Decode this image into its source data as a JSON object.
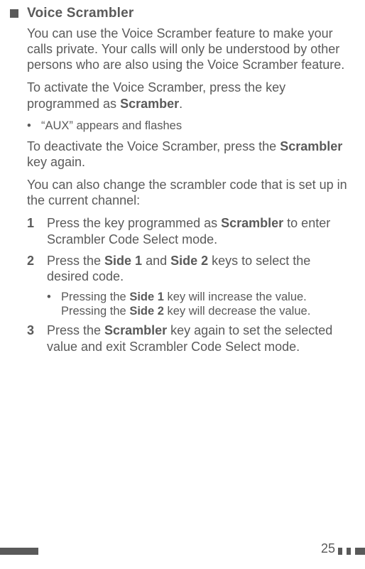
{
  "heading": "Voice Scrambler",
  "p1": "You can use the Voice Scramber feature to make your calls private.  Your calls will only be understood by other persons who are also using the Voice Scramber feature.",
  "p2a": "To activate the Voice Scramber, press the key programmed as ",
  "p2b": "Scramber",
  "p2c": ".",
  "bul1": "“AUX” appears and flashes",
  "p3a": "To deactivate the Voice Scramber, press the ",
  "p3b": "Scrambler",
  "p3c": " key again.",
  "p4": "You can also change the scrambler code that is set up in the current channel:",
  "s1a": "Press the key programmed as ",
  "s1b": "Scrambler",
  "s1c": " to enter Scrambler Code Select mode.",
  "s2a": "Press the ",
  "s2b": "Side 1",
  "s2c": " and ",
  "s2d": "Side 2",
  "s2e": " keys to select the desired code.",
  "s2sub_a": "Pressing the ",
  "s2sub_b": "Side 1",
  "s2sub_c": " key will increase the value. Pressing the ",
  "s2sub_d": "Side 2",
  "s2sub_e": " key will decrease the value.",
  "s3a": "Press the ",
  "s3b": "Scrambler",
  "s3c": " key again to set the selected value and exit Scrambler Code Select mode.",
  "n1": "1",
  "n2": "2",
  "n3": "3",
  "dot": "•",
  "pagenum": "25"
}
